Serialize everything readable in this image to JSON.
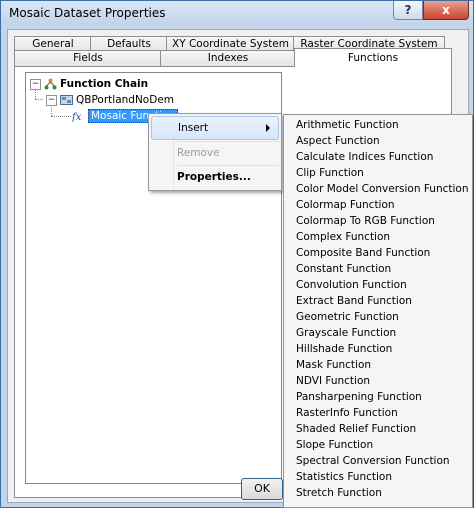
{
  "window": {
    "title": "Mosaic Dataset Properties",
    "help_label": "?",
    "close_label": "x"
  },
  "tabs_back": [
    {
      "label": "General"
    },
    {
      "label": "Defaults"
    },
    {
      "label": "XY Coordinate System"
    },
    {
      "label": "Raster Coordinate System"
    }
  ],
  "tabs_front": [
    {
      "label": "Fields"
    },
    {
      "label": "Indexes"
    },
    {
      "label": "Functions"
    }
  ],
  "tree": {
    "root": {
      "label": "Function Chain",
      "expander": "−"
    },
    "child": {
      "label": "QBPortlandNoDem",
      "expander": "−"
    },
    "leaf": {
      "label": "Mosaic Function"
    }
  },
  "context_menu": {
    "items": [
      {
        "label": "Insert"
      },
      {
        "label": "Remove"
      },
      {
        "label": "Properties..."
      }
    ]
  },
  "submenu": {
    "items": [
      "Arithmetic Function",
      "Aspect Function",
      "Calculate Indices Function",
      "Clip Function",
      "Color Model Conversion Function",
      "Colormap Function",
      "Colormap To RGB Function",
      "Complex Function",
      "Composite Band Function",
      "Constant Function",
      "Convolution Function",
      "Extract Band Function",
      "Geometric Function",
      "Grayscale Function",
      "Hillshade Function",
      "Mask Function",
      "NDVI Function",
      "Pansharpening Function",
      "RasterInfo Function",
      "Shaded Relief Function",
      "Slope Function",
      "Spectral Conversion Function",
      "Statistics Function",
      "Stretch Function"
    ]
  },
  "buttons": {
    "ok_label": "OK"
  }
}
